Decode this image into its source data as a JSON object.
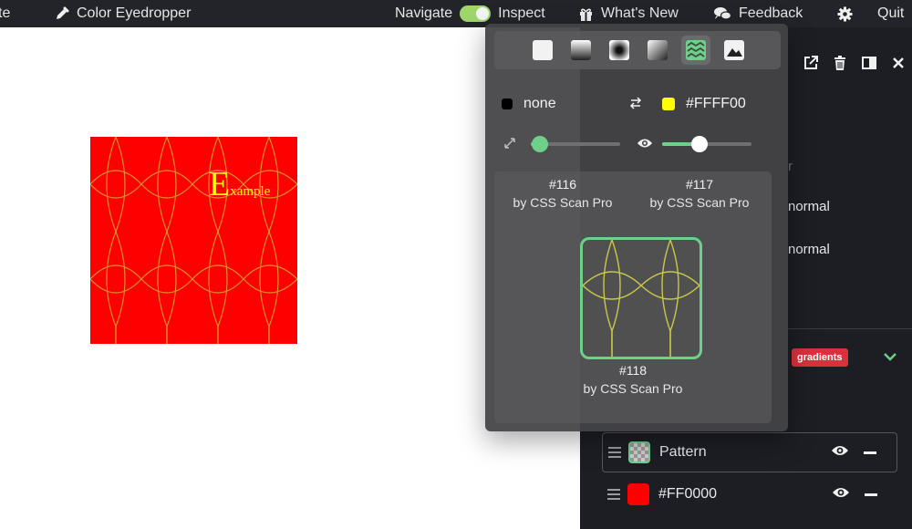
{
  "topbar": {
    "partial_label": "te",
    "eyedropper_label": "Color Eyedropper",
    "navigate_label": "Navigate",
    "inspect_label": "Inspect",
    "whats_new_label": "What's New",
    "feedback_label": "Feedback",
    "quit_label": "Quit"
  },
  "sample": {
    "letter": "E",
    "rest": "xample",
    "background_color": "#FF0000",
    "text_color": "#FFFF00"
  },
  "sidepanel": {
    "faint_tab": "r",
    "blend_1": "normal",
    "blend_2": "normal",
    "badge": "gradients",
    "layers": [
      {
        "label": "Pattern",
        "swatch": "checker"
      },
      {
        "label": "#FF0000",
        "swatch": "#FF0000"
      }
    ]
  },
  "popup": {
    "tabs": [
      "solid",
      "linear-gradient",
      "radial-gradient",
      "conic-gradient",
      "pattern",
      "image"
    ],
    "active_tab": "pattern",
    "color_left": {
      "label": "none",
      "swatch": "#000000"
    },
    "color_right": {
      "label": "#FFFF00",
      "swatch": "#FFFF00"
    },
    "size_level": 0.1,
    "opacity_level": 0.42,
    "patterns": [
      {
        "id": "#116",
        "author": "by CSS Scan Pro"
      },
      {
        "id": "#117",
        "author": "by CSS Scan Pro"
      },
      {
        "id": "#118",
        "author": "by CSS Scan Pro"
      }
    ]
  },
  "colors": {
    "accent": "#6FD08A",
    "toggle": "#9FD66A",
    "badge": "#D9323C"
  }
}
